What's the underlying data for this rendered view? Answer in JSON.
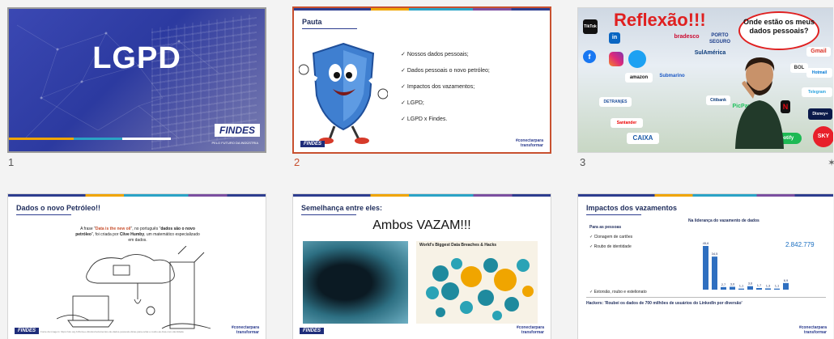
{
  "slides": [
    {
      "number": "1",
      "title": "LGPD",
      "brand": "FINDES",
      "brand_sub": "PELO FUTURO DA INDÚSTRIA"
    },
    {
      "number": "2",
      "title": "Pauta",
      "bullets": [
        "Nossos dados pessoais;",
        "Dados pessoais o novo petróleo;",
        "Impactos dos vazamentos;",
        "LGPD;",
        "LGPD x Findes."
      ],
      "brand": "FINDES",
      "hashtag_line1": "#conectarpara",
      "hashtag_line2": "transformar"
    },
    {
      "number": "3",
      "title": "Reflexão!!!",
      "cloud_text": "Onde estão os meus dados pessoais?",
      "logos": [
        "TikTok",
        "in",
        "bradesco",
        "PORTO SEGURO",
        "SulAmérica",
        "Gmail",
        "amazon",
        "Submarino",
        "BOL",
        "Hotmail",
        "DETRAN|ES",
        "PicPay",
        "Telegram",
        "Santander",
        "CAIXA",
        "Spotify",
        "SKY",
        "Disney+",
        "Citibank",
        "Netflix"
      ]
    },
    {
      "number": "4",
      "title": "Dados o novo Petróleo!!",
      "quote_parts": [
        "A frase \"",
        "Data is the new oil",
        "\", no português \"",
        "dados são o novo petróleo",
        "\", foi criada por ",
        "Clive Humby",
        ", um matemático especializado em dados."
      ],
      "brand": "FINDES",
      "footnote": "Fonte da imagem: https://ulo.org.br/feira-e-direitos/vazamentos-de-dados-pessoais-dicas-para-evitar-o-roubo-as-fcas-com-identidade",
      "hashtag_line1": "#conectarpara",
      "hashtag_line2": "transformar"
    },
    {
      "number": "5",
      "title": "Semelhança entre eles:",
      "headline": "Ambos VAZAM!!!",
      "infographic_title": "World's Biggest Data Breaches & Hacks",
      "brand": "FINDES",
      "hashtag_line1": "#conectarpara",
      "hashtag_line2": "transformar"
    },
    {
      "number": "6",
      "title": "Impactos dos vazamentos",
      "section": "Para as pessoas",
      "items": [
        "Clonagem de cartões",
        "Roubo de identidade"
      ],
      "extra_item": "Extorsão, roubo e estelionato",
      "chart_title": "Na liderança do vazamento de dados",
      "highlight_value": "2.842.779",
      "bar_values": [
        "45,6",
        "34,5",
        "2,7",
        "3,0",
        "1,1",
        "3,6",
        "1,7",
        "1,3",
        "1,1",
        "6,9"
      ],
      "hacker_headline": "Hackers: 'Roubei os dados de 700 milhões de usuários do LinkedIn por diversão'",
      "hashtag_line1": "#conectarpara",
      "hashtag_line2": "transformar"
    }
  ],
  "colors": {
    "accent": "#c8502f",
    "brand_blue": "#1f2d7a",
    "alert_red": "#e02020"
  }
}
